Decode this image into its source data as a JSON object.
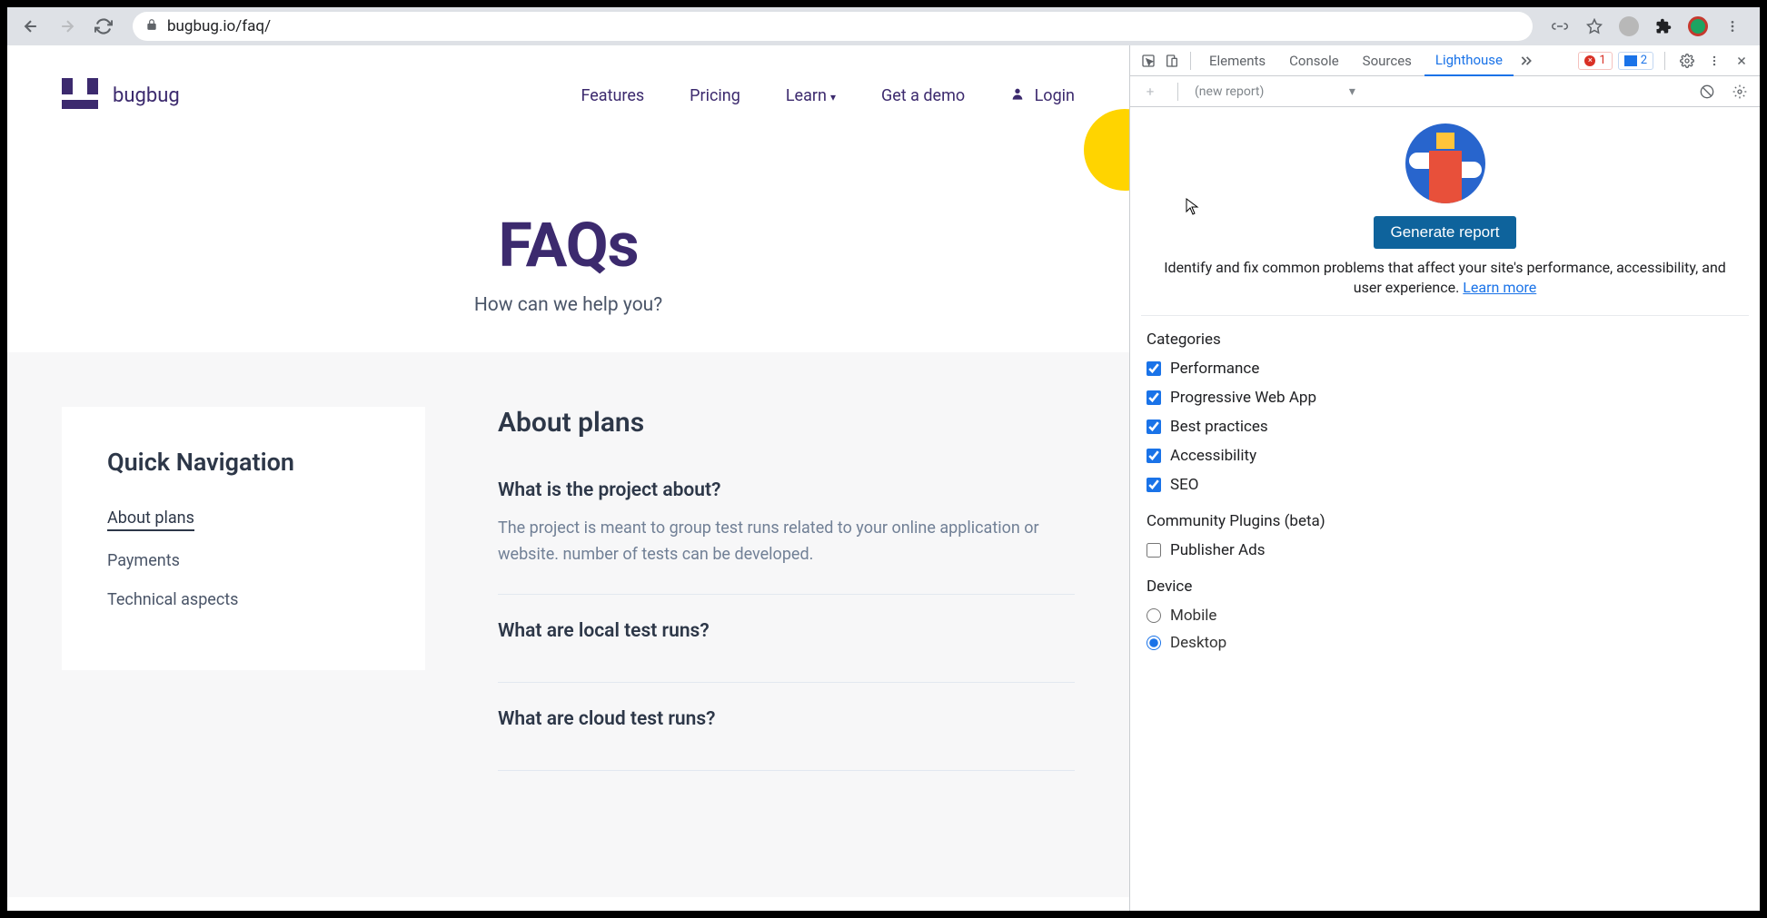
{
  "browser": {
    "url": "bugbug.io/faq/",
    "errors_count": "1",
    "messages_count": "2"
  },
  "site": {
    "logo_text": "bugbug",
    "nav": {
      "features": "Features",
      "pricing": "Pricing",
      "learn": "Learn",
      "demo": "Get a demo",
      "login": "Login"
    },
    "hero": {
      "title": "FAQs",
      "subtitle": "How can we help you?"
    },
    "sidebar": {
      "title": "Quick Navigation",
      "items": [
        "About plans",
        "Payments",
        "Technical aspects"
      ]
    },
    "section_title": "About plans",
    "faqs": [
      {
        "q": "What is the project about?",
        "a": "The project is meant to group test runs related to your online application or website. number of tests can be developed."
      },
      {
        "q": "What are local test runs?",
        "a": ""
      },
      {
        "q": "What are cloud test runs?",
        "a": ""
      }
    ]
  },
  "devtools": {
    "tabs": [
      "Elements",
      "Console",
      "Sources",
      "Lighthouse"
    ],
    "active_tab": "Lighthouse",
    "report_placeholder": "(new report)",
    "generate_button": "Generate report",
    "description": "Identify and fix common problems that affect your site's performance, accessibility, and user experience. ",
    "learn_more": "Learn more",
    "categories_title": "Categories",
    "categories": [
      {
        "label": "Performance",
        "checked": true
      },
      {
        "label": "Progressive Web App",
        "checked": true
      },
      {
        "label": "Best practices",
        "checked": true
      },
      {
        "label": "Accessibility",
        "checked": true
      },
      {
        "label": "SEO",
        "checked": true
      }
    ],
    "plugins_title": "Community Plugins (beta)",
    "plugins": [
      {
        "label": "Publisher Ads",
        "checked": false
      }
    ],
    "device_title": "Device",
    "devices": [
      {
        "label": "Mobile",
        "checked": false
      },
      {
        "label": "Desktop",
        "checked": true
      }
    ]
  }
}
